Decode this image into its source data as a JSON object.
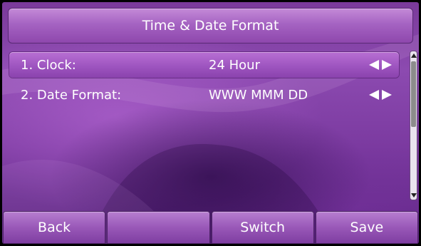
{
  "screen": {
    "title": "Time & Date Format",
    "items": [
      {
        "label": "1. Clock:",
        "value": "24 Hour",
        "selected": true
      },
      {
        "label": "2. Date Format:",
        "value": "WWW MMM DD",
        "selected": false
      }
    ]
  },
  "softkeys": [
    "Back",
    "",
    "Switch",
    "Save"
  ],
  "icons": {
    "value_arrows": [
      "arrow-left-icon",
      "arrow-right-icon"
    ],
    "scroll": [
      "scroll-up-icon",
      "scroll-down-icon"
    ]
  },
  "colors": {
    "background": "#7b3aa0",
    "selected_row": "#9e55c0",
    "text": "#ffffff"
  }
}
